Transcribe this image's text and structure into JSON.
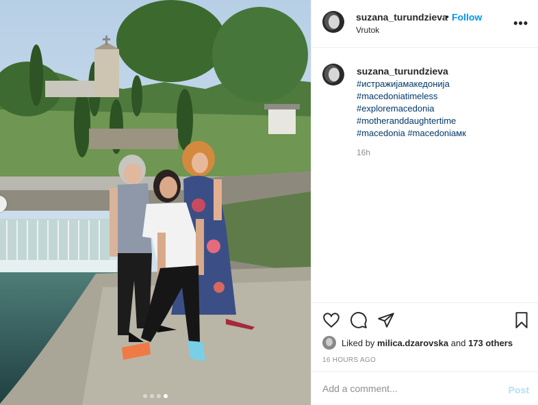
{
  "post": {
    "username": "suzana_turundzieva",
    "bullet": "•",
    "follow_label": "Follow",
    "location": "Vrutok",
    "more_label": "•••",
    "caption_tags": [
      "#истражијамакедонија",
      "#macedoniatimeless",
      "#exploremacedonia",
      "#motheranddaughtertime",
      "#macedonia #macedoniaмк"
    ],
    "time_short": "16h",
    "likes": {
      "prefix": "Liked by ",
      "user": "milica.dzarovska",
      "middle": " and ",
      "others": "173 others"
    },
    "time_ago": "16 HOURS AGO",
    "comment_placeholder": "Add a comment...",
    "post_label": "Post",
    "carousel": {
      "count": 4,
      "active_index": 3
    }
  },
  "icons": {
    "like": "heart-icon",
    "comment": "comment-icon",
    "share": "share-icon",
    "save": "bookmark-icon",
    "prev": "chevron-left-icon"
  },
  "colors": {
    "link": "#00376b",
    "follow": "#0095f6",
    "muted": "#8e8e8e",
    "post_disabled": "#b2dffc"
  }
}
